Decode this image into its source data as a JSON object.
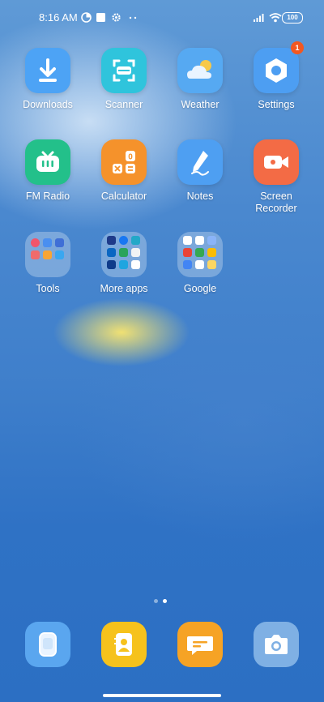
{
  "status_bar": {
    "time": "8:16 AM",
    "icons": [
      "data-saver-icon",
      "square-notification-icon",
      "gear-icon",
      "more-icon"
    ],
    "right_icons": [
      "signal-icon",
      "wifi-icon"
    ],
    "battery": "100"
  },
  "apps": [
    {
      "label": "Downloads",
      "icon": "download-icon",
      "color": "#4da3f5"
    },
    {
      "label": "Scanner",
      "icon": "scanner-icon",
      "color": "#2fc4dc"
    },
    {
      "label": "Weather",
      "icon": "weather-cloud-sun-icon",
      "color": "#56a9f2"
    },
    {
      "label": "Settings",
      "icon": "settings-gear-icon",
      "color": "#4d9ef2",
      "badge": "1"
    },
    {
      "label": "FM Radio",
      "icon": "radio-icon",
      "color": "#23c08a"
    },
    {
      "label": "Calculator",
      "icon": "calculator-icon",
      "color": "#f5922b"
    },
    {
      "label": "Notes",
      "icon": "pen-icon",
      "color": "#4e9ff2"
    },
    {
      "label": "Screen\nRecorder",
      "label_line1": "Screen",
      "label_line2": "Recorder",
      "icon": "video-camera-icon",
      "color": "#f36b45"
    }
  ],
  "folders": [
    {
      "label": "Tools"
    },
    {
      "label": "More apps"
    },
    {
      "label": "Google"
    }
  ],
  "page_indicator": {
    "pages": 2,
    "current": 2
  },
  "dock": [
    {
      "icon": "phone-icon",
      "color": "#5aa6ef"
    },
    {
      "icon": "contacts-icon",
      "color": "#f6c21c"
    },
    {
      "icon": "messaging-icon",
      "color": "#f6a325"
    },
    {
      "icon": "camera-icon",
      "color": "#7fb0e4"
    }
  ]
}
